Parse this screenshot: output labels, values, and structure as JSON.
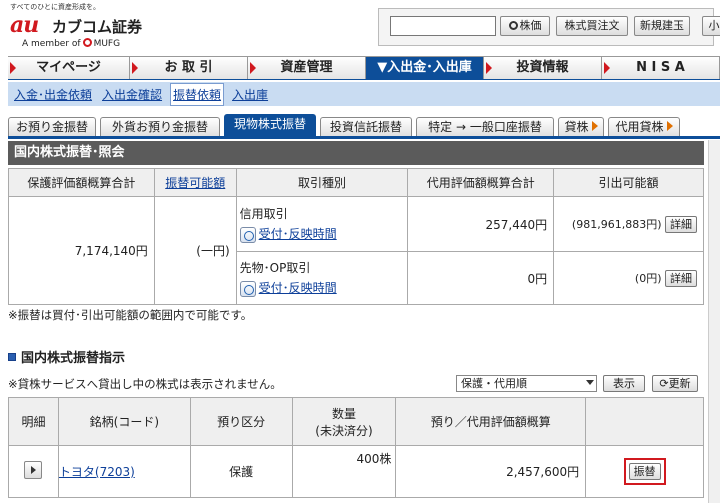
{
  "header": {
    "tagline": "すべてのひとに資産形成を。",
    "logo_mark": "au",
    "logo_text": "カブコム証券",
    "member_text": "A member of",
    "mufg": "MUFG",
    "stock_price_button": "株価",
    "stock_order_button": "株式買注文",
    "new_build_button": "新規建玉",
    "small_label": "小"
  },
  "nav": {
    "items": [
      {
        "label": "マイページ"
      },
      {
        "label": "お 取 引"
      },
      {
        "label": "資産管理"
      },
      {
        "label": "▼入出金･入出庫"
      },
      {
        "label": "投資情報"
      },
      {
        "label": "N I S A"
      }
    ]
  },
  "subnav": {
    "items": [
      {
        "label": "入金･出金依頼"
      },
      {
        "label": "入出金確認"
      },
      {
        "label": "振替依頼"
      },
      {
        "label": "入出庫"
      }
    ]
  },
  "tabs": [
    {
      "label": "お預り金振替"
    },
    {
      "label": "外貨お預り金振替"
    },
    {
      "label": "現物株式振替"
    },
    {
      "label": "投資信託振替"
    },
    {
      "label": "特定 → 一般口座振替"
    },
    {
      "label": "貸株"
    },
    {
      "label": "代用貸株"
    }
  ],
  "section_title": "国内株式振替･照会",
  "summary_table": {
    "headers": [
      "保護評価額概算合計",
      "振替可能額",
      "取引種別",
      "代用評価額概算合計",
      "引出可能額"
    ],
    "total_value": "7,174,140円",
    "transferable": "(一円)",
    "rows": [
      {
        "type": "信用取引",
        "link": "受付･反映時間",
        "substitute_value": "257,440円",
        "withdrawable": "(981,961,883円)",
        "detail": "詳細"
      },
      {
        "type": "先物･OP取引",
        "link": "受付･反映時間",
        "substitute_value": "0円",
        "withdrawable": "(0円)",
        "detail": "詳細"
      }
    ],
    "note": "※振替は買付･引出可能額の範囲内で可能です。"
  },
  "section2": {
    "title": "国内株式振替指示",
    "note": "※貸株サービスへ貸出し中の株式は表示されません。",
    "sort_select": "保護・代用順",
    "show_button": "表示",
    "refresh_button": "更新",
    "headers": [
      "明細",
      "銘柄(コード)",
      "預り区分",
      "数量",
      "(未決済分)",
      "預り／代用評価額概算"
    ],
    "rows": [
      {
        "name": "トヨタ(7203)",
        "category": "保護",
        "quantity": "400株",
        "value": "2,457,600円",
        "action": "振替"
      }
    ]
  }
}
